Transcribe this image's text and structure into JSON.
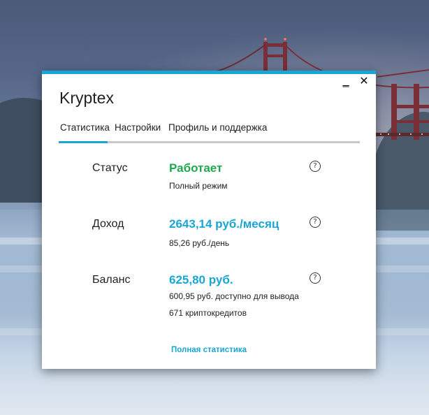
{
  "window": {
    "title": "Kryptex",
    "minimize_icon": "minimize-icon",
    "close_icon": "close-icon",
    "minimize_glyph": "‗",
    "close_glyph": "✕"
  },
  "tabs": [
    {
      "label": "Статистика",
      "active": true
    },
    {
      "label": "Настройки",
      "active": false
    },
    {
      "label": "Профиль и поддержка",
      "active": false
    }
  ],
  "status": {
    "label": "Статус",
    "value": "Работает",
    "sub": "Полный режим"
  },
  "income": {
    "label": "Доход",
    "value": "2643,14 руб./месяц",
    "sub": "85,26 руб./день"
  },
  "balance": {
    "label": "Баланс",
    "value": "625,80 руб.",
    "sub1": "600,95 руб. доступно для вывода",
    "sub2": "671 криптокредитов"
  },
  "help_glyph": "?",
  "full_stats_link": "Полная статистика",
  "colors": {
    "accent": "#1aa6d4",
    "status_green": "#1fa84f",
    "value_blue": "#1aa6d4"
  }
}
